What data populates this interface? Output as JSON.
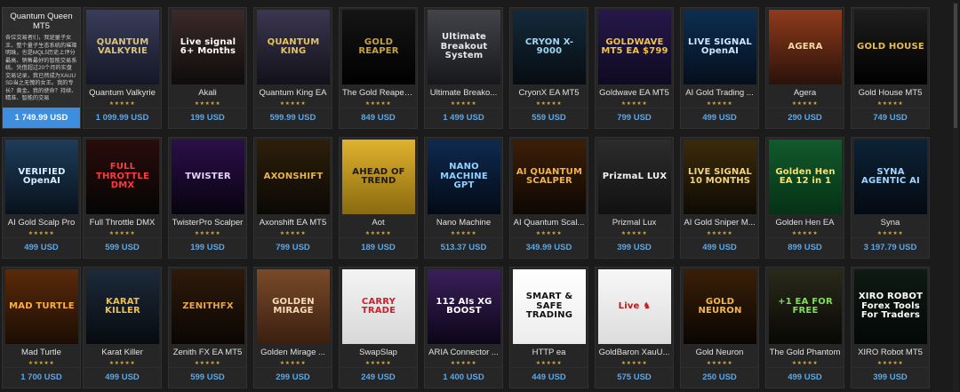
{
  "products": [
    {
      "title": "Quantum Queen MT5",
      "price": "1 749.99 USD",
      "expanded": true,
      "desc": "各位交易者们，我是量子女王，整个量子生态系统的璀璨明珠，也是MQL5历史上评分最高、销售最好的智能交易系统。凭借超过20个月的实盘交易记录，我已然成为XAUUSD当之无愧的女王。我的专长？黄金。我的使命？持续、精准、智能的交易"
    },
    {
      "title": "Quantum Valkyrie",
      "price": "1 099.99 USD",
      "rating": "★★★★★",
      "thumb": "QUANTUM VALKYRIE",
      "bg": "linear-gradient(#3a3d59,#141726)",
      "fg": "#d9c27a"
    },
    {
      "title": "Akali",
      "price": "199 USD",
      "rating": "★★★★★",
      "thumb": "Live signal 6+ Months",
      "bg": "linear-gradient(#3b2a29,#0e0c0c)",
      "fg": "#ffffff"
    },
    {
      "title": "Quantum King EA",
      "price": "599.99 USD",
      "rating": "★★★★★",
      "thumb": "QUANTUM KING",
      "bg": "linear-gradient(#3c3650,#12111a)",
      "fg": "#e6c35b"
    },
    {
      "title": "The Gold Reaper ...",
      "price": "849 USD",
      "rating": "★★★★★",
      "thumb": "GOLD REAPER",
      "bg": "linear-gradient(#151515,#000000)",
      "fg": "#c7a53a"
    },
    {
      "title": "Ultimate Breako...",
      "price": "1 499 USD",
      "rating": "★★★★★",
      "thumb": "Ultimate Breakout System",
      "bg": "linear-gradient(#42444a,#17181b)",
      "fg": "#e8e8e8"
    },
    {
      "title": "CryonX EA MT5",
      "price": "559 USD",
      "rating": "★★★★★",
      "thumb": "CRYON X-9000",
      "bg": "linear-gradient(#132a3b,#070c11)",
      "fg": "#9fd6f4"
    },
    {
      "title": "Goldwave EA MT5",
      "price": "799 USD",
      "rating": "★★★★★",
      "thumb": "GOLDWAVE MT5 EA $799",
      "bg": "linear-gradient(#26184b,#0f0a21)",
      "fg": "#f1c24a"
    },
    {
      "title": "AI Gold Trading ...",
      "price": "499 USD",
      "rating": "★★★★★",
      "thumb": "LIVE SIGNAL OpenAI",
      "bg": "linear-gradient(#0d2e52,#050f1c)",
      "fg": "#cfe7ff"
    },
    {
      "title": "Agera",
      "price": "290 USD",
      "rating": "★★★★★",
      "thumb": "AGERA",
      "bg": "linear-gradient(#8f3b1c,#2a120a)",
      "fg": "#f7d9a6"
    },
    {
      "title": "Gold House MT5",
      "price": "749 USD",
      "rating": "★★★★★",
      "thumb": "GOLD HOUSE",
      "bg": "linear-gradient(#1e1e1e,#000000)",
      "fg": "#e7bd4e"
    },
    {
      "title": "AI Gold Scalp Pro",
      "price": "499 USD",
      "rating": "★★★★★",
      "thumb": "VERIFIED OpenAI",
      "bg": "linear-gradient(#1e3c5a,#08111b)",
      "fg": "#d8eeff"
    },
    {
      "title": "Full Throttle DMX",
      "price": "599 USD",
      "rating": "★★★★★",
      "thumb": "FULL THROTTLE DMX",
      "bg": "linear-gradient(#2a0c0c,#050505)",
      "fg": "#ff3b3b"
    },
    {
      "title": "TwisterPro Scalper",
      "price": "199 USD",
      "rating": "★★★★★",
      "thumb": "TWISTER",
      "bg": "linear-gradient(#2b0f4a,#07030f)",
      "fg": "#e8d2ff"
    },
    {
      "title": "Axonshift EA MT5",
      "price": "799 USD",
      "rating": "★★★★★",
      "thumb": "AXONSHIFT",
      "bg": "linear-gradient(#2d1f0b,#0b0804)",
      "fg": "#e6b64a"
    },
    {
      "title": "Aot",
      "price": "189 USD",
      "rating": "★★★★★",
      "thumb": "AHEAD OF TREND",
      "bg": "linear-gradient(#e0b22e,#8a6a10)",
      "fg": "#1a1a1a"
    },
    {
      "title": "Nano Machine",
      "price": "513.37 USD",
      "rating": "★★★★★",
      "thumb": "NANO MACHINE GPT",
      "bg": "linear-gradient(#0f2a4f,#030a16)",
      "fg": "#8fd1ff"
    },
    {
      "title": "AI Quantum Scal...",
      "price": "349.99 USD",
      "rating": "★★★★★",
      "thumb": "AI QUANTUM SCALPER",
      "bg": "linear-gradient(#3d1f08,#0d0703)",
      "fg": "#f2b24a"
    },
    {
      "title": "Prizmal Lux",
      "price": "399 USD",
      "rating": "★★★★★",
      "thumb": "PrizmaL LUX",
      "bg": "linear-gradient(#2c2c2c,#111111)",
      "fg": "#f2f2f2"
    },
    {
      "title": "AI Gold Sniper M...",
      "price": "499 USD",
      "rating": "★★★★★",
      "thumb": "LIVE SIGNAL 10 MONTHS",
      "bg": "linear-gradient(#3b2b0a,#0f0b03)",
      "fg": "#f4d37a"
    },
    {
      "title": "Golden Hen EA",
      "price": "899 USD",
      "rating": "★★★★★",
      "thumb": "Golden Hen EA 12 in 1",
      "bg": "linear-gradient(#125a2c,#063116)",
      "fg": "#ffe066"
    },
    {
      "title": "Syna",
      "price": "3 197.79 USD",
      "rating": "★★★★★",
      "thumb": "SYNA AGENTIC AI",
      "bg": "linear-gradient(#0c2236,#040a12)",
      "fg": "#9fd6ff"
    },
    {
      "title": "Mad Turtle",
      "price": "1 700 USD",
      "rating": "★★★★★",
      "thumb": "MAD TURTLE",
      "bg": "linear-gradient(#5a2a0a,#1c0d03)",
      "fg": "#ffb03b"
    },
    {
      "title": "Karat Killer",
      "price": "499 USD",
      "rating": "★★★★★",
      "thumb": "KARAT KILLER",
      "bg": "linear-gradient(#1c2a3a,#070b10)",
      "fg": "#f0c04a"
    },
    {
      "title": "Zenith FX EA MT5",
      "price": "599 USD",
      "rating": "★★★★★",
      "thumb": "ZENITHFX",
      "bg": "linear-gradient(#2e1a0a,#0a0603)",
      "fg": "#e6a54a"
    },
    {
      "title": "Golden Mirage ...",
      "price": "299 USD",
      "rating": "★★★★★",
      "thumb": "GOLDEN MIRAGE",
      "bg": "linear-gradient(#7a4a2a,#3a1f10)",
      "fg": "#f7dcb4"
    },
    {
      "title": "SwapSlap",
      "price": "249 USD",
      "rating": "★★★★★",
      "thumb": "CARRY TRADE",
      "bg": "linear-gradient(#f4f4f4,#d8d8d8)",
      "fg": "#d11f2a"
    },
    {
      "title": "ARIA Connector ...",
      "price": "1 400 USD",
      "rating": "★★★★★",
      "thumb": "112 AIs XG BOOST",
      "bg": "linear-gradient(#3a1f5a,#0c0618)",
      "fg": "#ffffff"
    },
    {
      "title": "HTTP ea",
      "price": "449 USD",
      "rating": "★★★★★",
      "thumb": "SMART & SAFE TRADING",
      "bg": "linear-gradient(#ffffff,#ececec)",
      "fg": "#111111"
    },
    {
      "title": "GoldBaron XauU...",
      "price": "575 USD",
      "rating": "★★★★★",
      "thumb": "Live ♞",
      "bg": "linear-gradient(#f7f7f7,#dcdcdc)",
      "fg": "#c01818"
    },
    {
      "title": "Gold Neuron",
      "price": "250 USD",
      "rating": "★★★★★",
      "thumb": "GOLD NEURON",
      "bg": "linear-gradient(#3a1f08,#0a0502)",
      "fg": "#f5b84a"
    },
    {
      "title": "The Gold Phantom",
      "price": "499 USD",
      "rating": "★★★★★",
      "thumb": "+1 EA FOR FREE",
      "bg": "linear-gradient(#2a2a1a,#080805)",
      "fg": "#7fe05a"
    },
    {
      "title": "XIRO Robot MT5",
      "price": "399 USD",
      "rating": "★★★★★",
      "thumb": "XIRO ROBOT Forex Tools For Traders",
      "bg": "linear-gradient(#0e1a14,#040806)",
      "fg": "#ffffff"
    }
  ]
}
